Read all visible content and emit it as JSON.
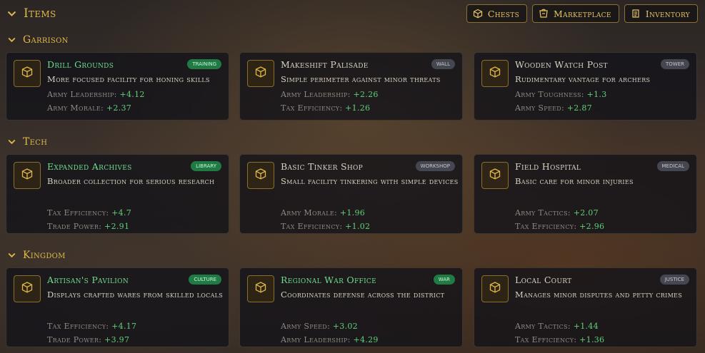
{
  "header": {
    "title": "Items",
    "buttons": [
      {
        "label": "Chests",
        "icon": "box-icon"
      },
      {
        "label": "Marketplace",
        "icon": "shop-icon"
      },
      {
        "label": "Inventory",
        "icon": "scroll-icon"
      }
    ]
  },
  "colors": {
    "gold": "#e0b84a",
    "green_badge": "#1f7a44",
    "gray_badge": "#444650",
    "stat_value": "#5fd07a"
  },
  "sections": [
    {
      "title": "Garrison",
      "cards": [
        {
          "name": "Drill Grounds",
          "badge": "training",
          "description": "More focused facility for honing skills",
          "stats": [
            {
              "label": "Army Leadership:",
              "value": "+4.12"
            },
            {
              "label": "Army Morale:",
              "value": "+2.37"
            }
          ]
        },
        {
          "name": "Makeshift Palisade",
          "badge": "wall",
          "description": "Simple perimeter against minor threats",
          "stats": [
            {
              "label": "Army Leadership:",
              "value": "+2.26"
            },
            {
              "label": "Tax Efficiency:",
              "value": "+1.26"
            }
          ]
        },
        {
          "name": "Wooden Watch Post",
          "badge": "tower",
          "description": "Rudimentary vantage for archers",
          "stats": [
            {
              "label": "Army Toughness:",
              "value": "+1.3"
            },
            {
              "label": "Army Speed:",
              "value": "+2.87"
            }
          ]
        }
      ]
    },
    {
      "title": "Tech",
      "cards": [
        {
          "name": "Expanded Archives",
          "badge": "library",
          "description": "Broader collection for serious research",
          "stats": [
            {
              "label": "Tax Efficiency:",
              "value": "+4.7"
            },
            {
              "label": "Trade Power:",
              "value": "+2.91"
            }
          ]
        },
        {
          "name": "Basic Tinker Shop",
          "badge": "workshop",
          "description": "Small facility tinkering with simple devices",
          "stats": [
            {
              "label": "Army Morale:",
              "value": "+1.96"
            },
            {
              "label": "Tax Efficiency:",
              "value": "+1.02"
            }
          ]
        },
        {
          "name": "Field Hospital",
          "badge": "medical",
          "description": "Basic care for minor injuries",
          "stats": [
            {
              "label": "Army Tactics:",
              "value": "+2.07"
            },
            {
              "label": "Tax Efficiency:",
              "value": "+2.96"
            }
          ]
        }
      ]
    },
    {
      "title": "Kingdom",
      "cards": [
        {
          "name": "Artisan's Pavilion",
          "badge": "culture",
          "description": "Displays crafted wares from skilled locals",
          "stats": [
            {
              "label": "Tax Efficiency:",
              "value": "+4.17"
            },
            {
              "label": "Trade Power:",
              "value": "+3.97"
            }
          ]
        },
        {
          "name": "Regional War Office",
          "badge": "war",
          "description": "Coordinates defense across the district",
          "stats": [
            {
              "label": "Army Speed:",
              "value": "+3.02"
            },
            {
              "label": "Army Leadership:",
              "value": "+4.29"
            }
          ]
        },
        {
          "name": "Local Court",
          "badge": "justice",
          "description": "Manages minor disputes and petty crimes",
          "stats": [
            {
              "label": "Army Tactics:",
              "value": "+1.44"
            },
            {
              "label": "Tax Efficiency:",
              "value": "+1.36"
            }
          ]
        }
      ]
    }
  ]
}
